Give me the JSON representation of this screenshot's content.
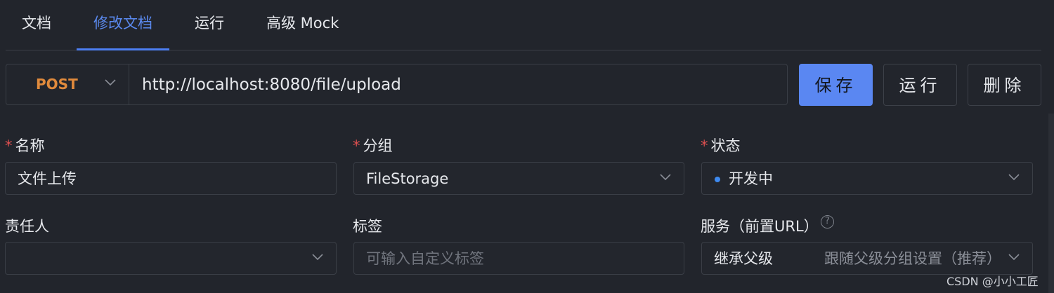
{
  "tabs": [
    {
      "label": "文档"
    },
    {
      "label": "修改文档"
    },
    {
      "label": "运行"
    },
    {
      "label": "高级 Mock"
    }
  ],
  "request": {
    "method": "POST",
    "url": "http://localhost:8080/file/upload"
  },
  "actions": {
    "save": "保存",
    "run": "运行",
    "delete": "删除"
  },
  "form": {
    "name": {
      "label": "名称",
      "required": true,
      "value": "文件上传"
    },
    "group": {
      "label": "分组",
      "required": true,
      "value": "FileStorage"
    },
    "status": {
      "label": "状态",
      "required": true,
      "value": "开发中"
    },
    "owner": {
      "label": "责任人",
      "value": ""
    },
    "tags": {
      "label": "标签",
      "placeholder": "可输入自定义标签"
    },
    "service": {
      "label": "服务（前置URL）",
      "value": "继承父级",
      "hint": "跟随父级分组设置（推荐）"
    }
  },
  "watermark": "CSDN @小小工匠",
  "colors": {
    "background": "#22252c",
    "accent": "#5a87f2",
    "method_post": "#e08a3c",
    "required": "#e05050",
    "status_dot": "#3e8af0"
  }
}
